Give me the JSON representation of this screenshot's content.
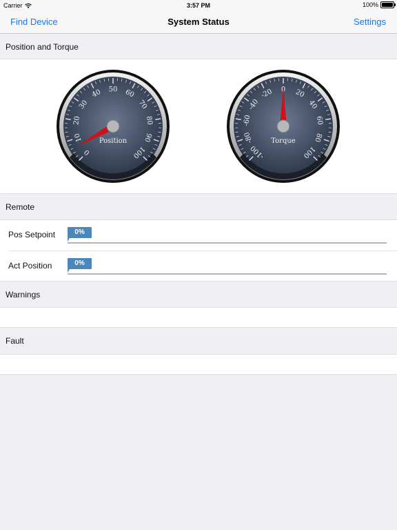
{
  "status_bar": {
    "carrier": "Carrier",
    "time": "3:57 PM",
    "battery": "100%"
  },
  "nav": {
    "left_button": "Find Device",
    "title": "System Status",
    "right_button": "Settings"
  },
  "sections": {
    "position_torque": "Position and Torque",
    "remote": "Remote",
    "warnings": "Warnings",
    "fault": "Fault"
  },
  "gauges": [
    {
      "label": "Position",
      "ticks": [
        "0",
        "10",
        "20",
        "30",
        "40",
        "50",
        "60",
        "70",
        "80",
        "90",
        "100"
      ],
      "min": 0,
      "max": 100,
      "value": 6
    },
    {
      "label": "Torque",
      "ticks": [
        "-100",
        "-80",
        "-60",
        "-40",
        "-20",
        "0",
        "20",
        "40",
        "60",
        "80",
        "100"
      ],
      "min": -100,
      "max": 100,
      "value": 0
    }
  ],
  "remote": {
    "pos_setpoint": {
      "label": "Pos Setpoint",
      "value_text": "0%",
      "value": 0
    },
    "act_position": {
      "label": "Act Position",
      "value_text": "0%",
      "value": 0
    }
  },
  "colors": {
    "accent": "#0a7aff",
    "needle": "#d0101a",
    "progress": "#4d86b9",
    "gauge_face": "#3d4a5e"
  }
}
